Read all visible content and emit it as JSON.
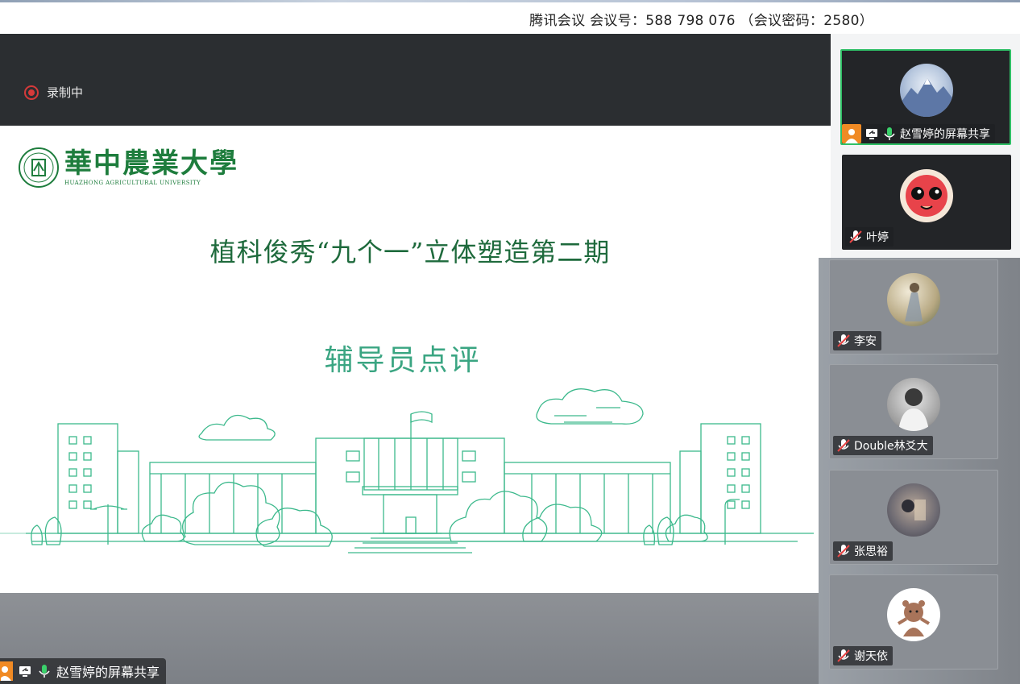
{
  "window": {
    "meeting_info": "腾讯会议 会议号：588 798 076 （会议密码：2580）"
  },
  "recording": {
    "label": "录制中",
    "color": "#d63a3a"
  },
  "slide": {
    "logo_cn": "華中農業大學",
    "logo_en": "HUAZHONG AGRICULTURAL UNIVERSITY",
    "title": "植科俊秀“九个一”立体塑造第二期",
    "subtitle": "辅导员点评",
    "accent_color": "#3aa582"
  },
  "participants": [
    {
      "name": "赵雪婷的屏幕共享",
      "mic": "on",
      "screen_share": true,
      "host": true
    },
    {
      "name": "叶婷",
      "mic": "muted"
    },
    {
      "name": "李安",
      "mic": "muted"
    },
    {
      "name": "Double林爻大",
      "mic": "muted"
    },
    {
      "name": "张思裕",
      "mic": "muted"
    },
    {
      "name": "谢天依",
      "mic": "muted"
    }
  ],
  "share_bar": {
    "label": "赵雪婷的屏幕共享"
  }
}
